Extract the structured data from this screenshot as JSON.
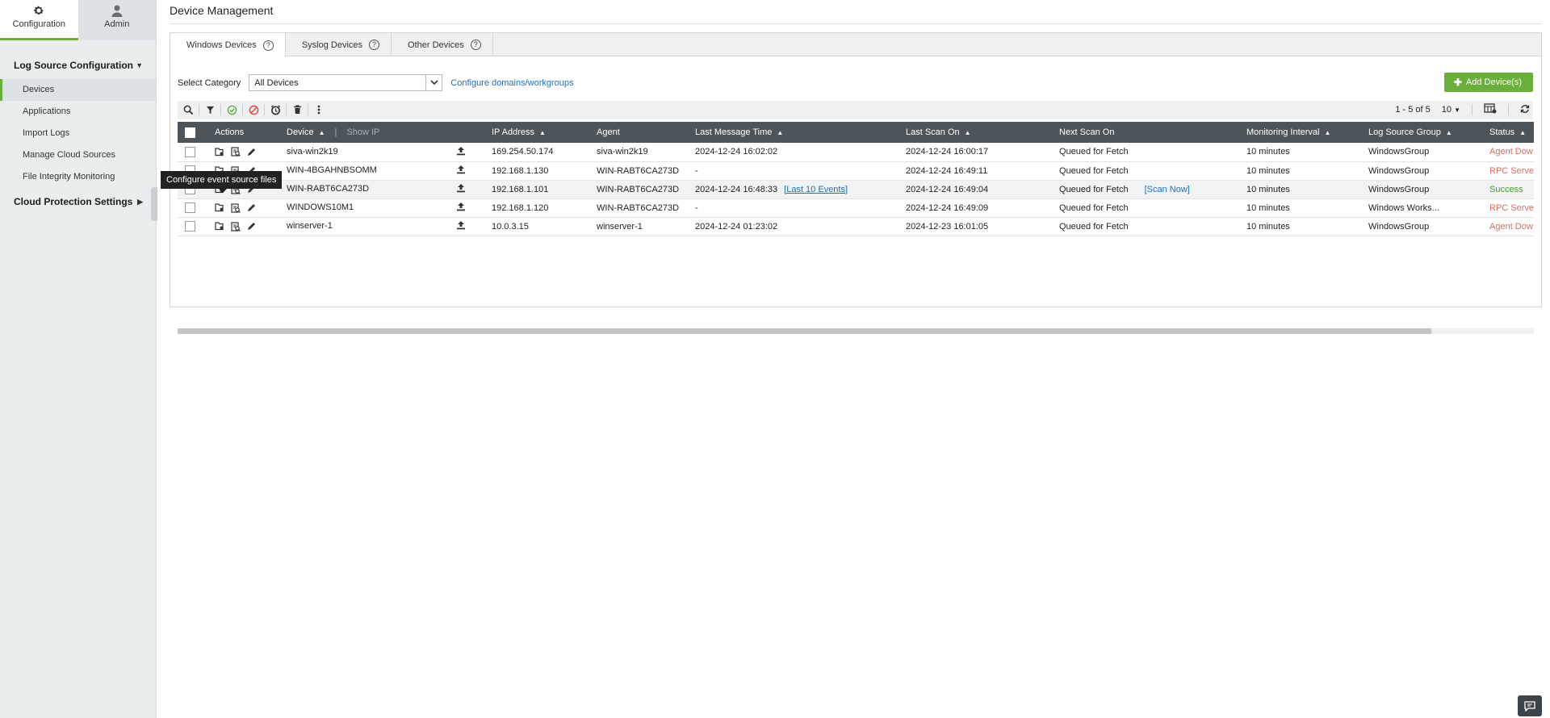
{
  "sidebar": {
    "tabs": [
      {
        "label": "Configuration",
        "icon": "gear-icon"
      },
      {
        "label": "Admin",
        "icon": "user-icon"
      }
    ],
    "sections": {
      "log_source": "Log Source Configuration",
      "cloud_protection": "Cloud Protection Settings"
    },
    "items": [
      {
        "label": "Devices"
      },
      {
        "label": "Applications"
      },
      {
        "label": "Import Logs"
      },
      {
        "label": "Manage Cloud Sources"
      },
      {
        "label": "File Integrity Monitoring"
      }
    ]
  },
  "page": {
    "title": "Device Management",
    "tabs": [
      {
        "label": "Windows Devices"
      },
      {
        "label": "Syslog Devices"
      },
      {
        "label": "Other Devices"
      }
    ],
    "help_glyph": "?"
  },
  "filter": {
    "label": "Select Category",
    "value": "All Devices",
    "configure_link": "Configure domains/workgroups",
    "add_button": "Add Device(s)"
  },
  "toolbar": {
    "pagination": "1 - 5 of 5",
    "page_size": "10"
  },
  "table": {
    "headers": {
      "actions": "Actions",
      "device": "Device",
      "show_ip": "Show IP",
      "ip": "IP Address",
      "agent": "Agent",
      "last_message": "Last Message Time",
      "last_scan": "Last Scan On",
      "next_scan": "Next Scan On",
      "interval": "Monitoring Interval",
      "group": "Log Source Group",
      "status": "Status"
    },
    "rows": [
      {
        "device": "siva-win2k19",
        "ip": "169.254.50.174",
        "agent": "siva-win2k19",
        "last_message": "2024-12-24 16:02:02",
        "events_link": "",
        "last_scan": "2024-12-24 16:00:17",
        "next_scan": "Queued for Fetch",
        "scan_link": "",
        "interval": "10 minutes",
        "group": "WindowsGroup",
        "status": "Agent Dow"
      },
      {
        "device": "WIN-4BGAHNBSOMM",
        "ip": "192.168.1.130",
        "agent": "WIN-RABT6CA273D",
        "last_message": "-",
        "events_link": "",
        "last_scan": "2024-12-24 16:49:11",
        "next_scan": "Queued for Fetch",
        "scan_link": "",
        "interval": "10 minutes",
        "group": "WindowsGroup",
        "status": "RPC Serve"
      },
      {
        "device": "WIN-RABT6CA273D",
        "ip": "192.168.1.101",
        "agent": "WIN-RABT6CA273D",
        "last_message": "2024-12-24 16:48:33",
        "events_link": "[Last 10 Events]",
        "last_scan": "2024-12-24 16:49:04",
        "next_scan": "Queued for Fetch",
        "scan_link": "[Scan Now]",
        "interval": "10 minutes",
        "group": "WindowsGroup",
        "status": "Success"
      },
      {
        "device": "WINDOWS10M1",
        "ip": "192.168.1.120",
        "agent": "WIN-RABT6CA273D",
        "last_message": "-",
        "events_link": "",
        "last_scan": "2024-12-24 16:49:09",
        "next_scan": "Queued for Fetch",
        "scan_link": "",
        "interval": "10 minutes",
        "group": "Windows Works...",
        "status": "RPC Serve"
      },
      {
        "device": "winserver-1",
        "ip": "10.0.3.15",
        "agent": "winserver-1",
        "last_message": "2024-12-24 01:23:02",
        "events_link": "",
        "last_scan": "2024-12-23 16:01:05",
        "next_scan": "Queued for Fetch",
        "scan_link": "",
        "interval": "10 minutes",
        "group": "WindowsGroup",
        "status": "Agent Dow"
      }
    ]
  },
  "tooltip": "Configure event source files",
  "colors": {
    "accent_green": "#6aae3c",
    "header_dark": "#4d555b",
    "link_blue": "#1f6fb5",
    "status_error": "#e06a5a",
    "status_success": "#4a9a2e"
  }
}
